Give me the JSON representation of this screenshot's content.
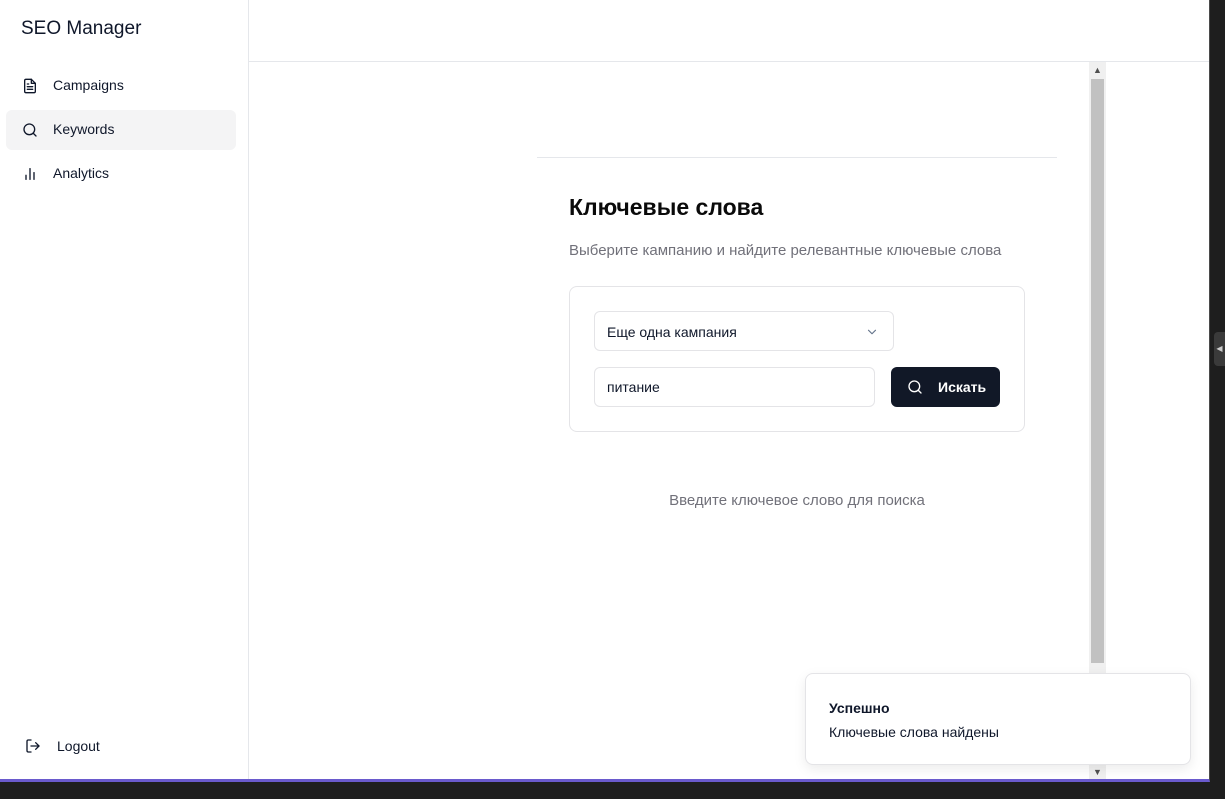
{
  "app": {
    "title": "SEO Manager"
  },
  "sidebar": {
    "items": [
      {
        "label": "Campaigns",
        "icon": "file-text-icon",
        "active": false
      },
      {
        "label": "Keywords",
        "icon": "search-icon",
        "active": true
      },
      {
        "label": "Analytics",
        "icon": "bar-chart-icon",
        "active": false
      }
    ],
    "logout": {
      "label": "Logout",
      "icon": "log-out-icon"
    }
  },
  "main": {
    "title": "Ключевые слова",
    "subtitle": "Выберите кампанию и найдите релевантные ключевые слова",
    "campaign_select": {
      "value": "Еще одна кампания",
      "icon": "chevron-down-icon"
    },
    "search": {
      "value": "питание",
      "button_label": "Искать",
      "button_icon": "search-icon"
    },
    "empty_hint": "Введите ключевое слово для поиска"
  },
  "toast": {
    "title": "Успешно",
    "message": "Ключевые слова найдены"
  },
  "colors": {
    "primary_button": "#111827",
    "active_nav": "#f4f4f5",
    "muted_text": "#71717a",
    "border": "#e4e4e7"
  }
}
